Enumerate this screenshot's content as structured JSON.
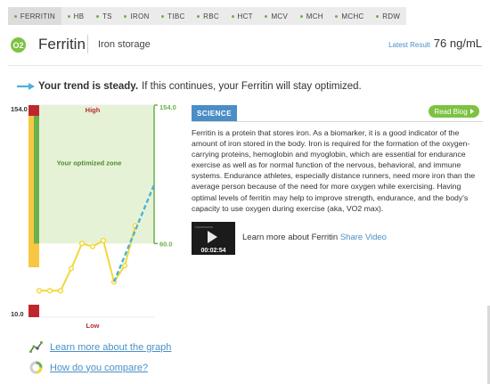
{
  "tabs": [
    {
      "label": "FERRITIN",
      "active": true
    },
    {
      "label": "HB",
      "active": false
    },
    {
      "label": "TS",
      "active": false
    },
    {
      "label": "IRON",
      "active": false
    },
    {
      "label": "TIBC",
      "active": false
    },
    {
      "label": "RBC",
      "active": false
    },
    {
      "label": "HCT",
      "active": false
    },
    {
      "label": "MCV",
      "active": false
    },
    {
      "label": "MCH",
      "active": false
    },
    {
      "label": "MCHC",
      "active": false
    },
    {
      "label": "RDW",
      "active": false
    }
  ],
  "header": {
    "icon_text": "O2",
    "title": "Ferritin",
    "subtitle": "Iron storage",
    "latest_label": "Latest Result",
    "latest_value": "76 ng/mL"
  },
  "trend": {
    "bold": "Your trend is steady.",
    "rest": "If this continues, your Ferritin will stay optimized."
  },
  "chart_data": {
    "type": "line",
    "y_max_label": "154.0",
    "y_min_label": "10.0",
    "high_label": "High",
    "low_label": "Low",
    "zone_label": "Your optimized zone",
    "zone_top_label": "154.0",
    "zone_bottom_label": "60.0",
    "ylim": [
      10,
      154
    ],
    "optimal_range": [
      60,
      154
    ],
    "series": [
      {
        "values": [
          28,
          28,
          28,
          43,
          60,
          58,
          62,
          34,
          45,
          72
        ]
      }
    ],
    "projection": {
      "values": [
        34,
        100
      ]
    },
    "colors": {
      "line": "#f2d835",
      "projection": "#4ab3d9",
      "zone": "#e6f2d5",
      "zone_border": "#6ab04c",
      "high_band": "#c0272d",
      "yellow_band": "#f7c744",
      "green_band": "#6ab04c"
    }
  },
  "links": {
    "graph": "Learn more about the graph",
    "compare": "How do you compare?"
  },
  "science": {
    "tab": "SCIENCE",
    "read_blog": "Read Blog",
    "text": "Ferritin is a protein that stores iron. As a biomarker, it is a good indicator of the amount of iron stored in the body. Iron is required for the formation of the oxygen-carrying proteins, hemoglobin and myoglobin, which are essential for endurance exercise as well as for normal function of the nervous, behavioral, and immune systems. Endurance athletes, especially distance runners, need more iron than the average person because of the need for more oxygen while exercising. Having optimal levels of ferritin may help to improve strength, endurance, and the body's capacity to use oxygen during exercise (aka, VO2 max)."
  },
  "video": {
    "duration": "00:02:54",
    "label": "Learn more about Ferritin",
    "share": "Share Video"
  }
}
